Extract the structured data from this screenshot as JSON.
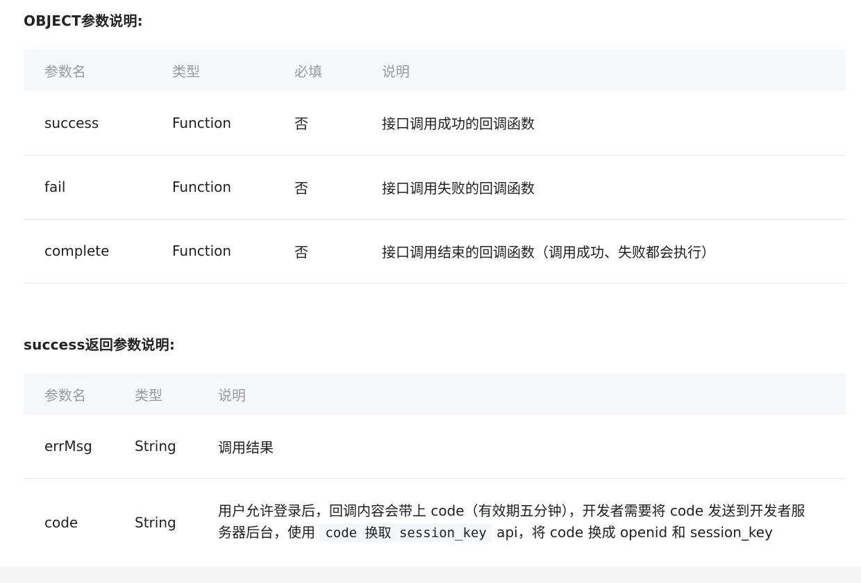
{
  "section1": {
    "title": "OBJECT参数说明:",
    "headers": [
      "参数名",
      "类型",
      "必填",
      "说明"
    ],
    "rows": [
      {
        "name": "success",
        "type": "Function",
        "required": "否",
        "desc": "接口调用成功的回调函数"
      },
      {
        "name": "fail",
        "type": "Function",
        "required": "否",
        "desc": "接口调用失败的回调函数"
      },
      {
        "name": "complete",
        "type": "Function",
        "required": "否",
        "desc": "接口调用结束的回调函数（调用成功、失败都会执行）"
      }
    ]
  },
  "section2": {
    "title": "success返回参数说明:",
    "headers": [
      "参数名",
      "类型",
      "说明"
    ],
    "rows": [
      {
        "name": "errMsg",
        "type": "String",
        "desc": "调用结果"
      },
      {
        "name": "code",
        "type": "String",
        "desc_before": "用户允许登录后，回调内容会带上 code（有效期五分钟），开发者需要将 code 发送到开发者服务器后台，使用 ",
        "desc_code": "code 换取 session_key",
        "desc_after": " api，将 code 换成 openid 和 session_key"
      }
    ]
  }
}
